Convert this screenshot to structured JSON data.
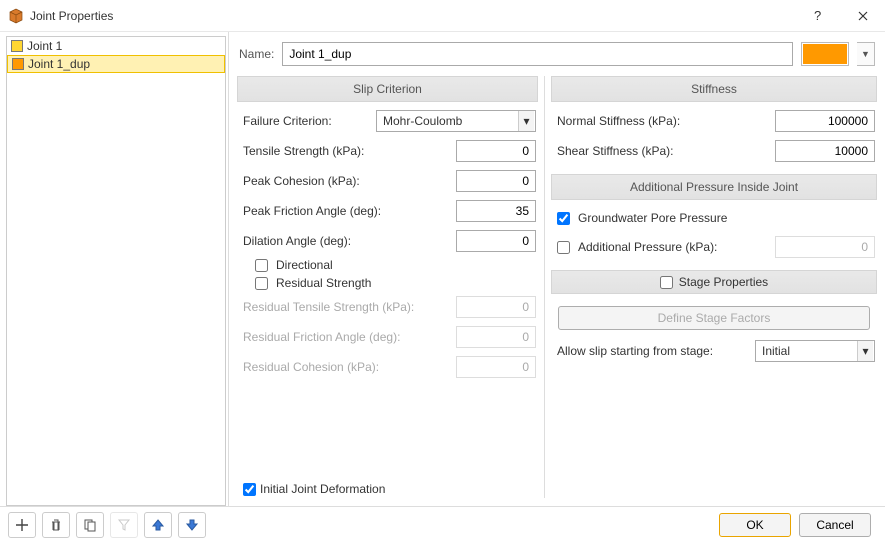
{
  "window": {
    "title": "Joint Properties"
  },
  "sidebar": {
    "joints": [
      {
        "label": "Joint 1",
        "color": "#ffd633",
        "selected": false
      },
      {
        "label": "Joint 1_dup",
        "color": "#ff9900",
        "selected": true
      }
    ]
  },
  "toolbar": {
    "add": "+",
    "delete": "Delete",
    "copy": "Copy",
    "filter": "Filter",
    "up": "Up",
    "down": "Down"
  },
  "name_row": {
    "label": "Name:",
    "value": "Joint 1_dup",
    "color": "#ff9900"
  },
  "slip": {
    "header": "Slip Criterion",
    "failure_label": "Failure Criterion:",
    "failure_value": "Mohr-Coulomb",
    "tensile_label": "Tensile Strength (kPa):",
    "tensile_value": "0",
    "cohesion_label": "Peak Cohesion (kPa):",
    "cohesion_value": "0",
    "peak_friction_label": "Peak Friction Angle (deg):",
    "peak_friction_value": "35",
    "dilation_label": "Dilation Angle (deg):",
    "dilation_value": "0",
    "directional_label": "Directional",
    "directional_checked": false,
    "residual_strength_label": "Residual Strength",
    "residual_strength_checked": false,
    "res_tensile_label": "Residual Tensile Strength (kPa):",
    "res_tensile_value": "0",
    "res_friction_label": "Residual Friction Angle (deg):",
    "res_friction_value": "0",
    "res_cohesion_label": "Residual Cohesion (kPa):",
    "res_cohesion_value": "0"
  },
  "stiffness": {
    "header": "Stiffness",
    "normal_label": "Normal Stiffness (kPa):",
    "normal_value": "100000",
    "shear_label": "Shear Stiffness (kPa):",
    "shear_value": "10000"
  },
  "pressure": {
    "header": "Additional Pressure Inside Joint",
    "groundwater_label": "Groundwater Pore Pressure",
    "groundwater_checked": true,
    "additional_label": "Additional Pressure (kPa):",
    "additional_checked": false,
    "additional_value": "0"
  },
  "stage": {
    "header": "Stage Properties",
    "header_checked": false,
    "define_btn": "Define Stage Factors",
    "allow_slip_label": "Allow slip starting from stage:",
    "allow_slip_value": "Initial"
  },
  "bottom": {
    "initial_deform_label": "Initial Joint Deformation",
    "initial_deform_checked": true
  },
  "footer": {
    "ok": "OK",
    "cancel": "Cancel"
  }
}
